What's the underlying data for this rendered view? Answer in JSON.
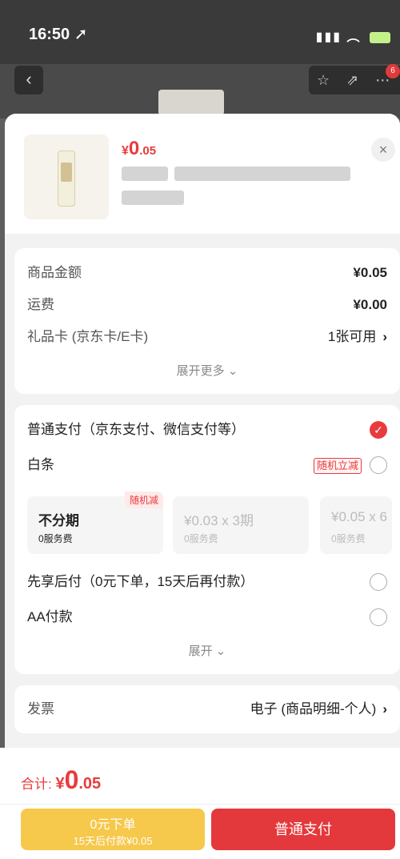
{
  "status_bar": {
    "time": "16:50 ➚",
    "signal": "▮▮▮",
    "wifi": "︵"
  },
  "nav": {
    "back": "‹",
    "actions": "☆ ⇗ ⋯",
    "badge": "6"
  },
  "product": {
    "price_cur": "¥",
    "price_int": "0",
    "price_dec": ".05",
    "close": "×"
  },
  "summary": {
    "goods_label": "商品金额",
    "goods_value": "¥0.05",
    "shipping_label": "运费",
    "shipping_value": "¥0.00",
    "giftcard_label": "礼品卡 (京东卡/E卡)",
    "giftcard_value": "1张可用",
    "expand_more": "展开更多 ⌄"
  },
  "payment": {
    "normal_label": "普通支付（京东支付、微信支付等）",
    "baitiao_label": "白条",
    "baitiao_tag": "随机立减",
    "installments": [
      {
        "title": "不分期",
        "fee": "0服务费",
        "ribbon": "随机减"
      },
      {
        "title": "¥0.03 x 3期",
        "fee": "0服务费"
      },
      {
        "title": "¥0.05 x 6",
        "fee": "0服务费"
      }
    ],
    "later_label": "先享后付（0元下单，15天后再付款）",
    "aa_label": "AA付款",
    "expand": "展开 ⌄"
  },
  "invoice": {
    "label": "发票",
    "value": "电子 (商品明细-个人)"
  },
  "footer": {
    "total_label": "合计: ",
    "total_cur": "¥",
    "total_int": "0",
    "total_dec": ".05",
    "later_btn_l1": "0元下单",
    "later_btn_l2": "15天后付款¥0.05",
    "pay_btn": "普通支付"
  },
  "colors": {
    "accent": "#e93b3d",
    "later_button": "#f6c84b",
    "pay_button": "#e4393c"
  }
}
